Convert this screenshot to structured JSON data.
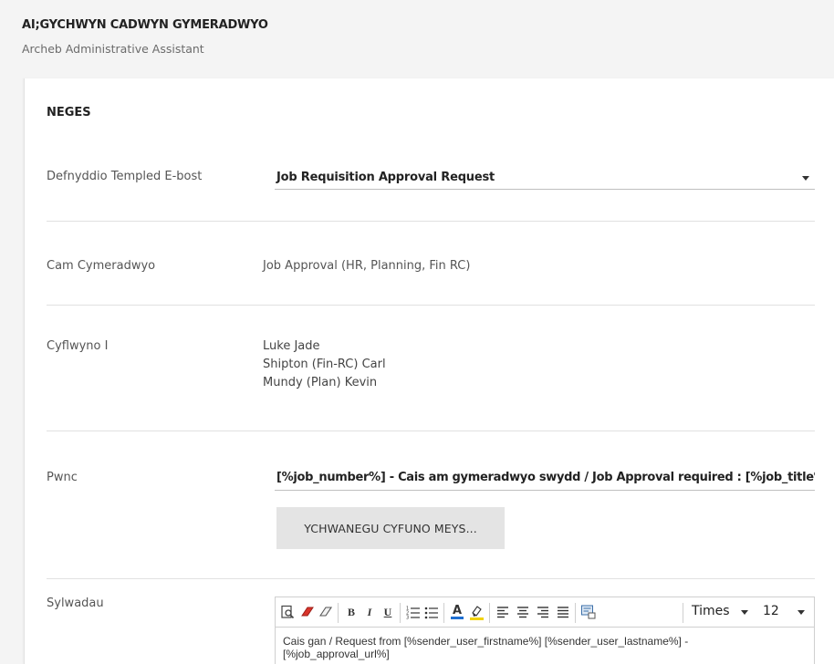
{
  "header": {
    "title": "AI;GYCHWYN CADWYN GYMERADWYO",
    "subtitle": "Archeb Administrative Assistant"
  },
  "form": {
    "section_title": "NEGES",
    "template": {
      "label": "Defnyddio Templed E-bost",
      "value": "Job Requisition Approval Request"
    },
    "stage": {
      "label": "Cam Cymeradwyo",
      "value": "Job Approval (HR, Planning, Fin RC)"
    },
    "recipients": {
      "label": "Cyflwyno I",
      "items": [
        "Luke Jade",
        "Shipton (Fin-RC) Carl",
        "Mundy (Plan) Kevin"
      ]
    },
    "subject": {
      "label": "Pwnc",
      "value": "[%job_number%] - Cais am gymeradwyo swydd / Job Approval required : [%job_title%]"
    },
    "merge_button_label": "YCHWANEGU CYFUNO MEYS...",
    "comments": {
      "label": "Sylwadau",
      "font": "Times",
      "size": "12",
      "body": "Cais gan / Request from [%sender_user_firstname%] [%sender_user_lastname%] - [%job_approval_url%]"
    }
  },
  "icons": {
    "preview": "preview-icon",
    "eraser_red": "eraser-red-icon",
    "eraser": "eraser-icon",
    "bold": "B",
    "italic": "I",
    "underline": "U",
    "ordered_list": "ordered-list-icon",
    "unordered_list": "unordered-list-icon",
    "font_color": "A",
    "highlight": "highlight-icon",
    "align_left": "align-left-icon",
    "align_center": "align-center-icon",
    "align_right": "align-right-icon",
    "justify": "justify-icon",
    "insert_field": "insert-field-icon"
  },
  "colors": {
    "eraser_red": "#d9342b",
    "font_color_bar": "#1f6fd1",
    "highlight_bar": "#f2d200"
  }
}
